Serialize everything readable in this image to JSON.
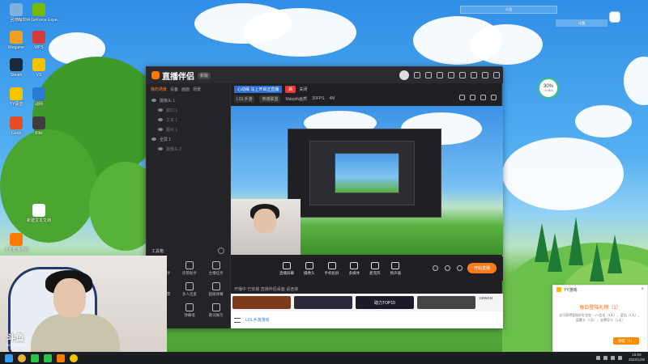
{
  "desktop": {
    "icons": [
      {
        "label": "回收站",
        "icon": "recycle-bin-icon",
        "color": "#7fb1e0"
      },
      {
        "label": "NVIDIA GeForce Expe…",
        "icon": "nvidia-icon",
        "color": "#76b900"
      },
      {
        "label": "Wegame",
        "icon": "wegame-icon",
        "color": "#f0a020"
      },
      {
        "label": "WPS",
        "icon": "wps-icon",
        "color": "#d23b3b"
      },
      {
        "label": "Steam",
        "icon": "steam-icon",
        "color": "#1b2838"
      },
      {
        "label": "VS",
        "icon": "yellow-app-icon",
        "color": "#f2c200"
      },
      {
        "label": "YY语音",
        "icon": "yy-icon",
        "color": "#f6c500"
      },
      {
        "label": "战网",
        "icon": "battlenet-icon",
        "color": "#2a7bd8"
      },
      {
        "label": "Geek",
        "icon": "geek-icon",
        "color": "#e44d26"
      },
      {
        "label": "Blitz",
        "icon": "blitz-icon",
        "color": "#3c3c3c"
      },
      {
        "label": "新建文本文档",
        "icon": "text-file-icon",
        "color": "#ffffff"
      },
      {
        "label": "斗鱼直播伴侣",
        "icon": "douyu-companion-icon",
        "color": "#ff7a00"
      }
    ]
  },
  "app": {
    "title": "直播伴侣",
    "version": "新版",
    "tabs": [
      {
        "label": "我的场景",
        "active": true
      },
      {
        "label": "设备",
        "active": false
      },
      {
        "label": "画面",
        "active": false
      },
      {
        "label": "场景",
        "active": false
      }
    ],
    "scenes": [
      {
        "label": "摄像头 1",
        "sub": false
      },
      {
        "label": "窗口 1",
        "sub": true
      },
      {
        "label": "文本 1",
        "sub": true
      },
      {
        "label": "图片 1",
        "sub": true
      },
      {
        "label": "全屏 1",
        "sub": false
      },
      {
        "label": "摄像头 2",
        "sub": true
      }
    ],
    "toolbox_title": "工具箱",
    "tools": [
      {
        "label": "弹幕助手",
        "icon": "danmu-icon"
      },
      {
        "label": "房管助手",
        "icon": "moderator-icon"
      },
      {
        "label": "主播任务",
        "icon": "task-icon"
      },
      {
        "label": "抽奖投票",
        "icon": "lottery-icon"
      },
      {
        "label": "多人连麦",
        "icon": "multi-mic-icon"
      },
      {
        "label": "超级弹幕",
        "icon": "super-danmu-icon"
      },
      {
        "label": "互动",
        "icon": "interact-icon"
      },
      {
        "label": "弹幕墙",
        "icon": "danmu-wall-icon"
      },
      {
        "label": "歌词展示",
        "icon": "lyrics-icon"
      }
    ],
    "notice": {
      "text": "心动缘 马上开启正直播",
      "badge": "新",
      "close": "关闭"
    },
    "infobar": {
      "game": "LOL手游",
      "category": "英雄联盟",
      "quality": "Mdepth画质",
      "fps": "30FPS",
      "kbps": "4M"
    },
    "bottom_tools": [
      {
        "label": "直播屏幕",
        "icon": "screen-icon"
      },
      {
        "label": "摄像头",
        "icon": "camera-icon"
      },
      {
        "label": "手机投屏",
        "icon": "phone-cast-icon"
      },
      {
        "label": "多媒体",
        "icon": "media-icon"
      },
      {
        "label": "麦克风",
        "icon": "microphone-icon"
      },
      {
        "label": "扬声器",
        "icon": "speaker-icon"
      }
    ],
    "start_live": "开始直播",
    "hint": "开播中 已安装 直播伴侣桌面 请连接",
    "game_strip": [
      {
        "label": "",
        "color": "#7b3a1c"
      },
      {
        "label": "",
        "color": "#2a2a3a"
      },
      {
        "label": "助力TOP10",
        "color": "#1a1a2a"
      },
      {
        "label": "",
        "color": "#444"
      }
    ],
    "strip_right": "1306434",
    "chat_placeholder": "LOL手游游戏"
  },
  "widgets": {
    "top_bar": "斗鱼",
    "top_bar2": "斗鱼",
    "stat_value": "30%",
    "stat_sub": "↑0.0K/s"
  },
  "stream": {
    "brand": "斗鱼",
    "url": "DOUYU.COM"
  },
  "popup": {
    "header": "YY游戏",
    "title": "每日登陆礼物（1）",
    "body": "全可获得登陆好礼包包：YY会员（1天），蓝钻（1天），蓝魔卡（1天），金牌导卡（1天）",
    "button": "领取（1）"
  },
  "taskbar": {
    "apps": [
      {
        "icon": "windows-start-icon",
        "color": "#3a9cf0"
      },
      {
        "icon": "chrome-icon",
        "color": "#e8b33a"
      },
      {
        "icon": "wechat-icon",
        "color": "#2dc24b"
      },
      {
        "icon": "wechat2-icon",
        "color": "#2dc24b"
      },
      {
        "icon": "douyu-task-icon",
        "color": "#ff7a00"
      },
      {
        "icon": "yy-task-icon",
        "color": "#f6c500"
      }
    ],
    "time": "15:09",
    "date": "2022/1/26"
  }
}
